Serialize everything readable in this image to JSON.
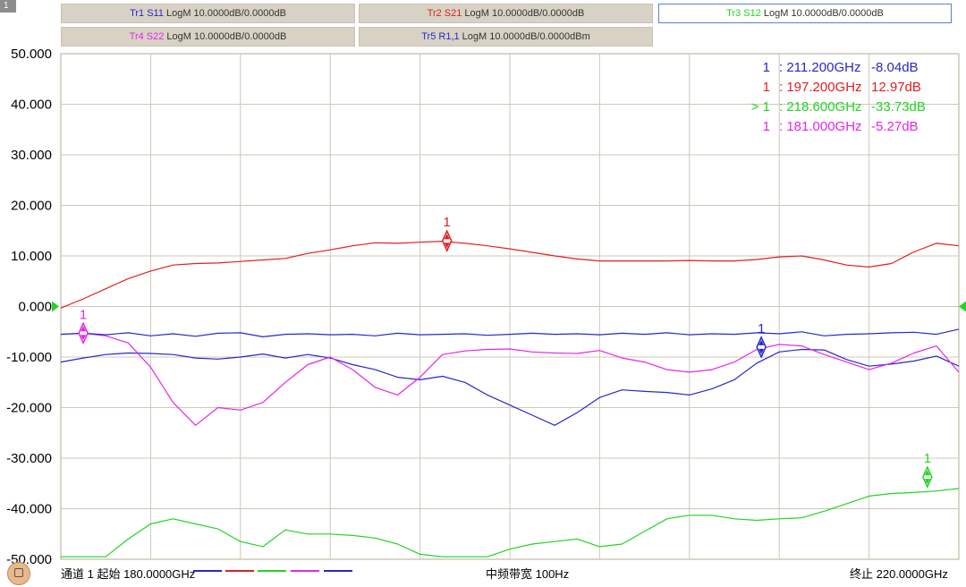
{
  "channel": {
    "number": "1"
  },
  "traces": [
    {
      "name": "Tr1 S11",
      "format": "LogM 10.0000dB/0.0000dB",
      "color": "#2828c8"
    },
    {
      "name": "Tr2 S21",
      "format": "LogM 10.0000dB/0.0000dB",
      "color": "#e02020"
    },
    {
      "name": "Tr3 S12",
      "format": "LogM 10.0000dB/0.0000dB",
      "color": "#22d422",
      "active": true
    },
    {
      "name": "Tr4 S22",
      "format": "LogM 10.0000dB/0.0000dB",
      "color": "#e626e6"
    },
    {
      "name": "Tr5 R1,1",
      "format": "LogM 10.0000dB/0.0000dBm",
      "color": "#2828c8"
    }
  ],
  "markers_table": [
    {
      "prefix": "1",
      "freq": ": 211.200GHz",
      "value": "-8.04dB",
      "color": "#2828c8"
    },
    {
      "prefix": "1",
      "freq": ": 197.200GHz",
      "value": "12.97dB",
      "color": "#e02020"
    },
    {
      "prefix": "> 1",
      "freq": ": 218.600GHz",
      "value": "-33.73dB",
      "color": "#22d422"
    },
    {
      "prefix": "1",
      "freq": ": 181.000GHz",
      "value": "-5.27dB",
      "color": "#e626e6"
    }
  ],
  "footer": {
    "start_label": "通道 1 起始 180.0000GHz",
    "ifbw_label": "中频带宽 100Hz",
    "stop_label": "终止 220.0000GHz"
  },
  "chart_data": {
    "type": "line",
    "xlabel": "",
    "ylabel": "",
    "xlim": [
      180,
      220
    ],
    "ylim": [
      -50,
      50
    ],
    "yticks": [
      "50.000",
      "40.000",
      "30.000",
      "20.000",
      "10.000",
      "0.000",
      "-10.000",
      "-20.000",
      "-30.000",
      "-40.000",
      "-50.000"
    ],
    "grid": true,
    "reference_level": 0,
    "series": [
      {
        "name": "Tr1 S11",
        "color": "#2828c8",
        "x": [
          180,
          181,
          182,
          183,
          184,
          185,
          186,
          187,
          188,
          189,
          190,
          191,
          192,
          193,
          194,
          195,
          196,
          197,
          198,
          199,
          200,
          201,
          202,
          203,
          204,
          205,
          206,
          207,
          208,
          209,
          210,
          211,
          212,
          213,
          214,
          215,
          216,
          217,
          218,
          219,
          220
        ],
        "y": [
          -11,
          -10.2,
          -9.5,
          -9.2,
          -9.3,
          -9.5,
          -10.2,
          -10.4,
          -10,
          -9.4,
          -10.2,
          -9.5,
          -10.2,
          -11.5,
          -12.5,
          -14,
          -14.5,
          -13.8,
          -15,
          -17.5,
          -19.5,
          -21.5,
          -23.5,
          -21,
          -18,
          -16.5,
          -16.8,
          -17,
          -17.5,
          -16.3,
          -14.5,
          -11.2,
          -9,
          -8.5,
          -8.6,
          -10.5,
          -11.8,
          -11.4,
          -10.8,
          -9.8,
          -11.8
        ]
      },
      {
        "name": "Tr2 S21",
        "color": "#e02020",
        "x": [
          180,
          181,
          182,
          183,
          184,
          185,
          186,
          187,
          188,
          189,
          190,
          191,
          192,
          193,
          194,
          195,
          196,
          197,
          198,
          199,
          200,
          201,
          202,
          203,
          204,
          205,
          206,
          207,
          208,
          209,
          210,
          211,
          212,
          213,
          214,
          215,
          216,
          217,
          218,
          219,
          220
        ],
        "y": [
          -0.3,
          1.5,
          3.5,
          5.5,
          7,
          8.2,
          8.5,
          8.6,
          8.9,
          9.2,
          9.5,
          10.5,
          11.2,
          12,
          12.6,
          12.5,
          12.7,
          12.9,
          12.5,
          12,
          11.4,
          10.7,
          10,
          9.4,
          9,
          9,
          9,
          9,
          9.1,
          9,
          9,
          9.3,
          9.8,
          10,
          9.2,
          8.2,
          7.8,
          8.5,
          10.8,
          12.5,
          12
        ]
      },
      {
        "name": "Tr3 S12",
        "color": "#22d422",
        "x": [
          180,
          181,
          182,
          183,
          184,
          185,
          186,
          187,
          188,
          189,
          190,
          191,
          192,
          193,
          194,
          195,
          196,
          197,
          198,
          199,
          200,
          201,
          202,
          203,
          204,
          205,
          206,
          207,
          208,
          209,
          210,
          211,
          212,
          213,
          214,
          215,
          216,
          217,
          218,
          219,
          220
        ],
        "y": [
          -49.5,
          -49.5,
          -49.5,
          -46,
          -43,
          -42,
          -43,
          -44,
          -46.5,
          -47.5,
          -44.2,
          -45,
          -45,
          -45.3,
          -45.8,
          -47,
          -49,
          -49.5,
          -49.5,
          -49.5,
          -48,
          -47,
          -46.5,
          -46,
          -47.5,
          -47,
          -44.5,
          -42,
          -41.3,
          -41.3,
          -42,
          -42.3,
          -42,
          -41.8,
          -40.5,
          -39,
          -37.5,
          -37,
          -36.8,
          -36.5,
          -36
        ]
      },
      {
        "name": "Tr4 S22",
        "color": "#e626e6",
        "x": [
          180,
          181,
          182,
          183,
          184,
          185,
          186,
          187,
          188,
          189,
          190,
          191,
          192,
          193,
          194,
          195,
          196,
          197,
          198,
          199,
          200,
          201,
          202,
          203,
          204,
          205,
          206,
          207,
          208,
          209,
          210,
          211,
          212,
          213,
          214,
          215,
          216,
          217,
          218,
          219,
          220
        ],
        "y": [
          -5.5,
          -5.3,
          -5.8,
          -7.2,
          -12,
          -19,
          -23.5,
          -20,
          -20.5,
          -19,
          -15,
          -11.5,
          -10,
          -12.5,
          -16,
          -17.5,
          -14,
          -9.5,
          -8.8,
          -8.5,
          -8.4,
          -9,
          -9.2,
          -9.3,
          -8.7,
          -10.2,
          -11,
          -12.5,
          -13,
          -12.5,
          -11,
          -8.5,
          -7.5,
          -7.8,
          -9.5,
          -11,
          -12.5,
          -11.2,
          -9.2,
          -7.8,
          -13
        ]
      },
      {
        "name": "Tr5 R1,1",
        "color": "#2828c8",
        "x": [
          180,
          181,
          182,
          183,
          184,
          185,
          186,
          187,
          188,
          189,
          190,
          191,
          192,
          193,
          194,
          195,
          196,
          197,
          198,
          199,
          200,
          201,
          202,
          203,
          204,
          205,
          206,
          207,
          208,
          209,
          210,
          211,
          212,
          213,
          214,
          215,
          216,
          217,
          218,
          219,
          220
        ],
        "y": [
          -5.5,
          -5.3,
          -5.6,
          -5.2,
          -5.8,
          -5.4,
          -5.9,
          -5.3,
          -5.2,
          -6,
          -5.5,
          -5.4,
          -5.6,
          -5.5,
          -5.8,
          -5.3,
          -5.6,
          -5.5,
          -5.4,
          -5.7,
          -5.5,
          -5.3,
          -5.5,
          -5.4,
          -5.6,
          -5.3,
          -5.5,
          -5.2,
          -5.6,
          -5.4,
          -5.5,
          -5.2,
          -5.4,
          -5,
          -5.8,
          -5.5,
          -5.4,
          -5.2,
          -5.1,
          -5.5,
          -4.5
        ]
      }
    ],
    "markers": [
      {
        "label": "1",
        "x": 211.2,
        "y": -8.04,
        "color": "#2828c8"
      },
      {
        "label": "1",
        "x": 197.2,
        "y": 12.97,
        "color": "#e02020"
      },
      {
        "label": "1",
        "x": 218.6,
        "y": -33.73,
        "color": "#22d422"
      },
      {
        "label": "1",
        "x": 181.0,
        "y": -5.27,
        "color": "#e626e6"
      }
    ]
  }
}
